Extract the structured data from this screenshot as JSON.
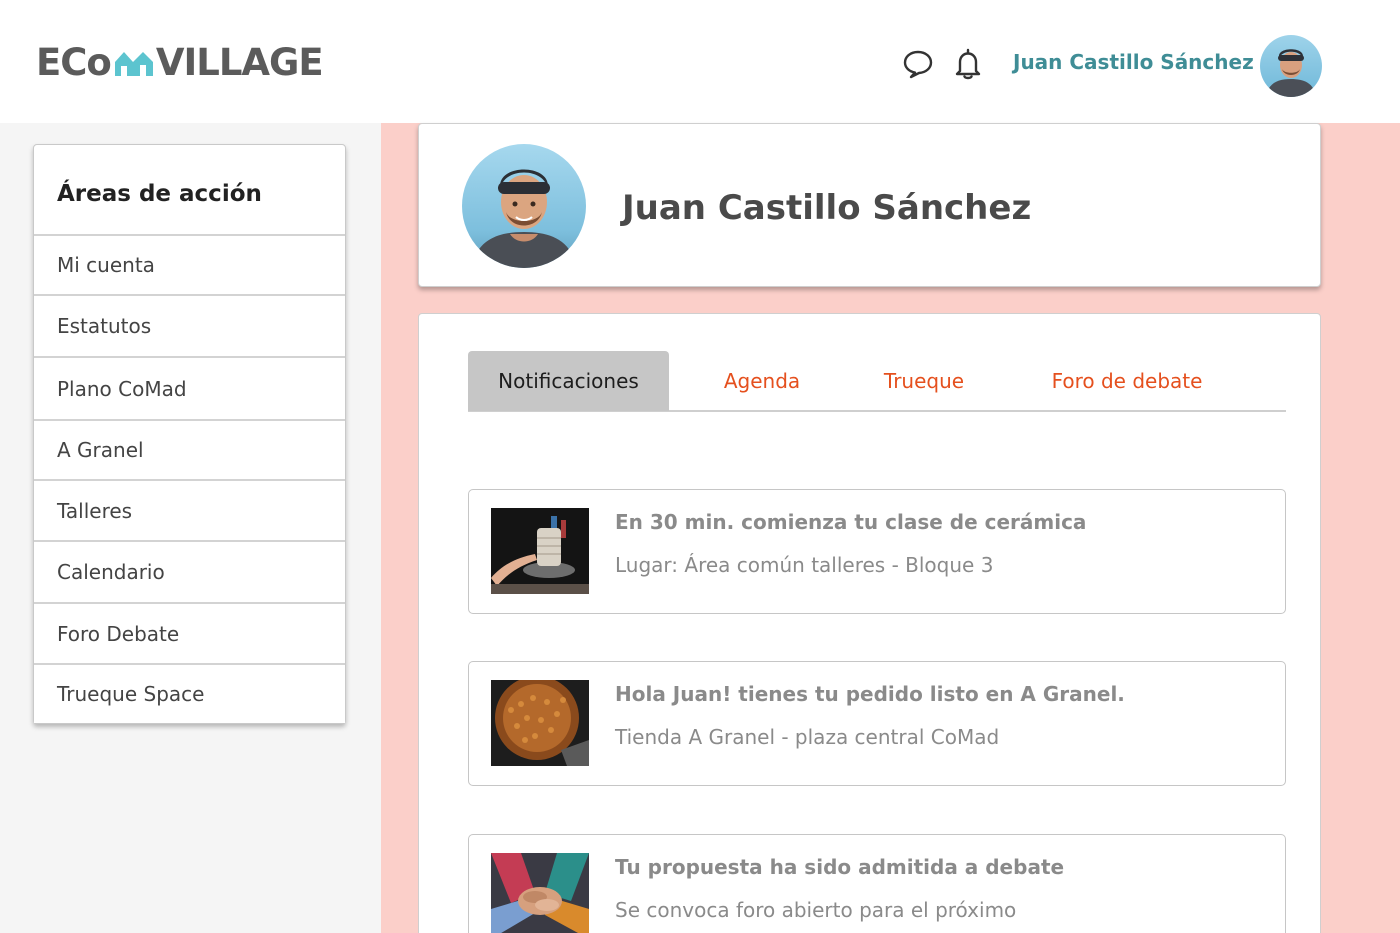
{
  "header": {
    "logo_text_start": "ECo",
    "logo_text_end": "VILLAGE",
    "icons": [
      "chat-bubble-icon",
      "bell-icon"
    ],
    "user_name": "Juan Castillo Sánchez"
  },
  "sidebar": {
    "title": "Áreas de acción",
    "items": [
      {
        "label": "Mi cuenta"
      },
      {
        "label": "Estatutos"
      },
      {
        "label": "Plano CoMad"
      },
      {
        "label": "A Granel"
      },
      {
        "label": "Talleres"
      },
      {
        "label": "Calendario"
      },
      {
        "label": "Foro Debate"
      },
      {
        "label": "Trueque Space"
      }
    ]
  },
  "profile": {
    "name": "Juan Castillo Sánchez"
  },
  "tabs": [
    {
      "label": "Notificaciones",
      "active": true
    },
    {
      "label": "Agenda",
      "active": false
    },
    {
      "label": "Trueque",
      "active": false
    },
    {
      "label": "Foro de debate",
      "active": false
    }
  ],
  "notifications": [
    {
      "title": "En 30 min. comienza tu clase de cerámica",
      "subtitle": "Lugar: Área común talleres - Bloque 3",
      "image": "ceramics-class-photo"
    },
    {
      "title": "Hola Juan! tienes tu pedido listo en A Granel.",
      "subtitle": "Tienda A Granel - plaza central CoMad",
      "image": "bulk-grains-photo"
    },
    {
      "title": "Tu propuesta ha sido admitida a debate",
      "subtitle": "Se convoca foro abierto para el próximo",
      "image": "group-hands-photo"
    }
  ],
  "colors": {
    "logo": "#5b5b5b",
    "logo_houses": "#5cc4cf",
    "user_name": "#3f8d96",
    "tab_inactive": "#e5501e",
    "tab_active_bg": "#c6c6c6",
    "main_background": "#fbcfc9",
    "sidebar_background": "#f5f5f5"
  }
}
